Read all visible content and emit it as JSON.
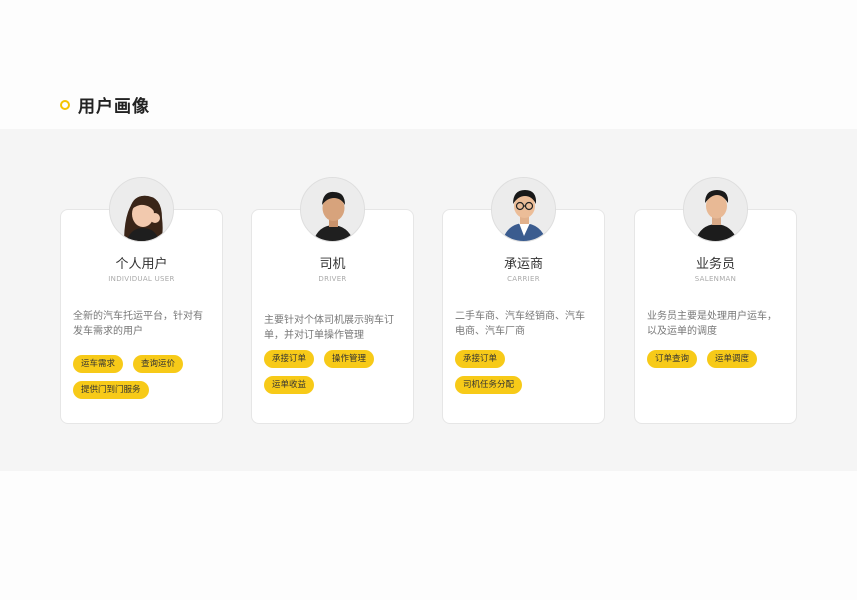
{
  "section": {
    "title": "用户画像"
  },
  "colors": {
    "accent": "#f5c400",
    "tag_bg": "#f7ca18",
    "band_bg": "#f5f5f5"
  },
  "cards": [
    {
      "name": "个人用户",
      "en": "INDIVIDUAL USER",
      "avatar_icon": "female-user-avatar",
      "desc": "全新的汽车托运平台，针对有发车需求的用户",
      "tags": [
        "运车需求",
        "查询运价",
        "提供门到门服务"
      ]
    },
    {
      "name": "司机",
      "en": "DRIVER",
      "avatar_icon": "male-driver-avatar",
      "desc": "主要针对个体司机展示驹车订单，并对订单操作管理",
      "tags": [
        "承接订单",
        "操作管理",
        "运单收益"
      ]
    },
    {
      "name": "承运商",
      "en": "CARRIER",
      "avatar_icon": "carrier-avatar",
      "desc": "二手车商、汽车经销商、汽车电商、汽车厂商",
      "tags": [
        "承接订单",
        "司机任务分配"
      ]
    },
    {
      "name": "业务员",
      "en": "SALENMAN",
      "avatar_icon": "salesman-avatar",
      "desc": "业务员主要是处理用户运车，以及运单的调度",
      "tags": [
        "订单查询",
        "运单调度"
      ]
    }
  ]
}
